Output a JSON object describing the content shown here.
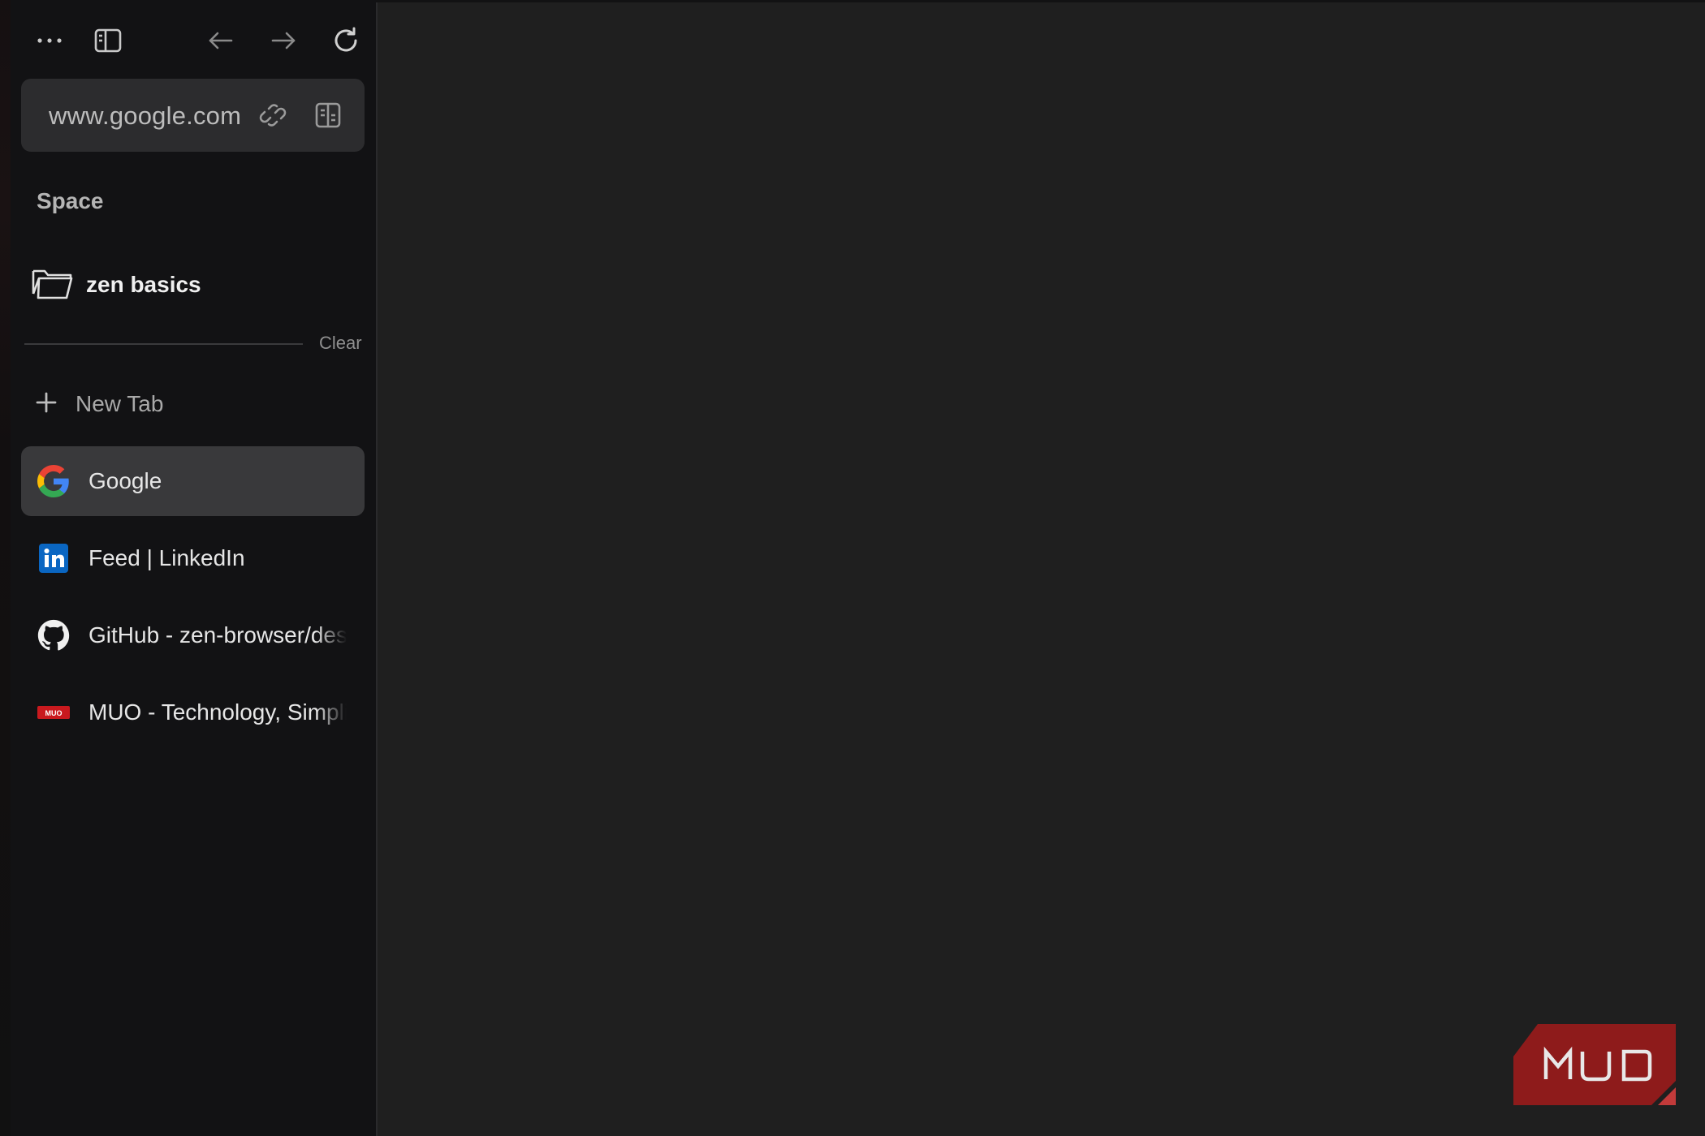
{
  "toolbar": {
    "menu_icon": "more-horizontal-icon",
    "sidebar_icon": "sidebar-toggle-icon",
    "back_icon": "arrow-left-icon",
    "forward_icon": "arrow-right-icon",
    "reload_icon": "reload-icon"
  },
  "urlbar": {
    "url": "www.google.com",
    "copy_link_icon": "link-icon",
    "reader_icon": "page-layout-icon"
  },
  "sidebar": {
    "space_label": "Space",
    "folder": {
      "label": "zen basics",
      "icon": "folder-icon"
    },
    "clear_label": "Clear",
    "new_tab_label": "New Tab",
    "tabs": [
      {
        "label": "Google",
        "icon": "google-icon",
        "active": true
      },
      {
        "label": "Feed | LinkedIn",
        "icon": "linkedin-icon",
        "active": false
      },
      {
        "label": "GitHub - zen-browser/desktop",
        "icon": "github-icon",
        "active": false
      },
      {
        "label": "MUO - Technology, Simplified.",
        "icon": "muo-icon",
        "active": false
      }
    ]
  },
  "watermark": {
    "text": "MUO",
    "color": "#8e1b1b"
  },
  "colors": {
    "sidebar_bg": "#121214",
    "content_bg": "#1f1f1f",
    "urlbar_bg": "#2c2c2e",
    "active_tab_bg": "#39393b",
    "linkedin_blue": "#0a66c2",
    "muo_red": "#c9191e"
  }
}
